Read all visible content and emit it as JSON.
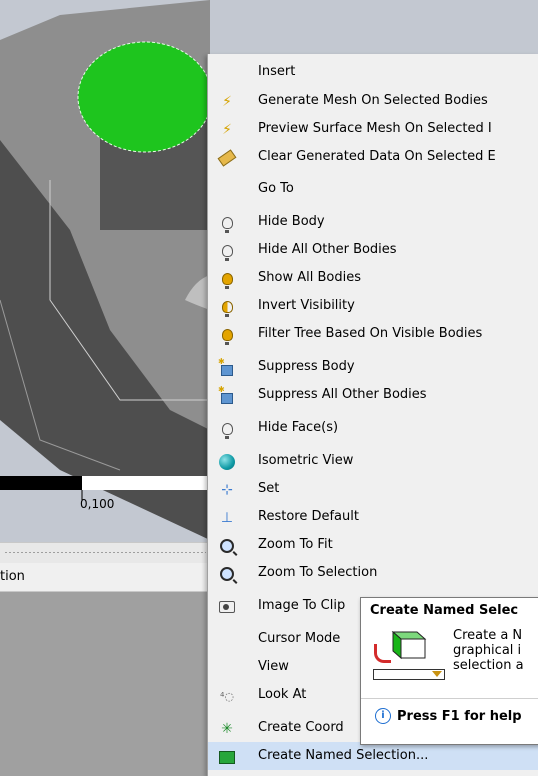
{
  "viewport": {
    "scale_label": "0,100"
  },
  "panel": {
    "header_label": "tion"
  },
  "menu": {
    "items": [
      {
        "label": "Insert",
        "icon": "none"
      },
      {
        "label": "Generate Mesh On Selected Bodies",
        "icon": "lightning-bolt-icon"
      },
      {
        "label": "Preview Surface Mesh On Selected I",
        "icon": "lightning-bolt-icon"
      },
      {
        "label": "Clear Generated Data On Selected E",
        "icon": "eraser-icon"
      },
      {
        "label": "Go To",
        "icon": "none"
      },
      {
        "label": "Hide Body",
        "icon": "bulb-off-icon"
      },
      {
        "label": "Hide All Other Bodies",
        "icon": "bulb-off-icon"
      },
      {
        "label": "Show All Bodies",
        "icon": "bulb-on-icon"
      },
      {
        "label": "Invert Visibility",
        "icon": "bulb-invert-icon"
      },
      {
        "label": "Filter Tree Based On Visible Bodies",
        "icon": "bulb-on-icon"
      },
      {
        "label": "Suppress Body",
        "icon": "suppress-cube-icon"
      },
      {
        "label": "Suppress All Other Bodies",
        "icon": "suppress-cube-icon"
      },
      {
        "label": "Hide Face(s)",
        "icon": "bulb-off-icon"
      },
      {
        "label": "Isometric View",
        "icon": "sphere-icon"
      },
      {
        "label": "Set",
        "icon": "axes-icon"
      },
      {
        "label": "Restore Default",
        "icon": "axes-icon"
      },
      {
        "label": "Zoom To Fit",
        "icon": "magnifier-icon"
      },
      {
        "label": "Zoom To Selection",
        "icon": "magnifier-icon"
      },
      {
        "label": "Image To Clip",
        "icon": "camera-icon"
      },
      {
        "label": "Cursor Mode",
        "icon": "none"
      },
      {
        "label": "View",
        "icon": "none"
      },
      {
        "label": "Look At",
        "icon": "look-at-icon"
      },
      {
        "label": "Create Coord",
        "icon": "coordinate-system-icon"
      },
      {
        "label": "Create Named Selection...",
        "icon": "named-selection-icon"
      }
    ]
  },
  "tooltip": {
    "title": "Create Named Selec",
    "desc_line1": "Create a N",
    "desc_line2": "graphical i",
    "desc_line3": "selection a",
    "help": "Press F1 for help"
  },
  "colors": {
    "highlight": "#cfe0f5",
    "menu_bg": "#f0f0f0",
    "selected_face": "#1ec51e",
    "body_gray": "#8c8c8c"
  }
}
